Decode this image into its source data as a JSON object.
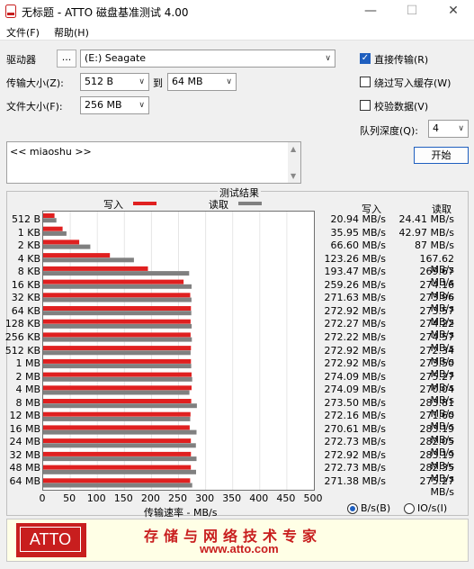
{
  "window": {
    "title": "无标题 - ATTO 磁盘基准测试 4.00",
    "minimize": "—",
    "maximize": "☐",
    "close": "✕"
  },
  "menu": [
    "文件(F)",
    "帮助(H)"
  ],
  "drive": {
    "label": "驱动器",
    "browse": "...",
    "value": "(E:) Seagate"
  },
  "transfer": {
    "label": "传输大小(Z):",
    "from": "512 B",
    "to_label": "到",
    "to": "64 MB"
  },
  "filesize": {
    "label": "文件大小(F):",
    "value": "256 MB"
  },
  "options": {
    "direct_io": {
      "label": "直接传输(R)",
      "checked": true
    },
    "bypass_cache": {
      "label": "绕过写入缓存(W)",
      "checked": false
    },
    "verify": {
      "label": "校验数据(V)",
      "checked": false
    }
  },
  "queue": {
    "label": "队列深度(Q):",
    "value": "4"
  },
  "start_button": "开始",
  "notes_text": "<< miaoshu >>",
  "results": {
    "title": "测试结果",
    "write_label": "写入",
    "read_label": "读取",
    "col_write": "写入",
    "col_read": "读取",
    "rows": [
      {
        "size": "512 B",
        "write": "20.94 MB/s",
        "read": "24.41 MB/s"
      },
      {
        "size": "1 KB",
        "write": "35.95 MB/s",
        "read": "42.97 MB/s"
      },
      {
        "size": "2 KB",
        "write": "66.60 MB/s",
        "read": "87 MB/s"
      },
      {
        "size": "4 KB",
        "write": "123.26 MB/s",
        "read": "167.62 MB/s"
      },
      {
        "size": "8 KB",
        "write": "193.47 MB/s",
        "read": "269.67 MB/s"
      },
      {
        "size": "16 KB",
        "write": "259.26 MB/s",
        "read": "274.16 MB/s"
      },
      {
        "size": "32 KB",
        "write": "271.63 MB/s",
        "read": "273.96 MB/s"
      },
      {
        "size": "64 KB",
        "write": "272.92 MB/s",
        "read": "273.57 MB/s"
      },
      {
        "size": "128 KB",
        "write": "272.27 MB/s",
        "read": "274.22 MB/s"
      },
      {
        "size": "256 KB",
        "write": "272.22 MB/s",
        "read": "274.57 MB/s"
      },
      {
        "size": "512 KB",
        "write": "272.92 MB/s",
        "read": "272.34 MB/s"
      },
      {
        "size": "1 MB",
        "write": "272.92 MB/s",
        "read": "273.50 MB/s"
      },
      {
        "size": "2 MB",
        "write": "274.09 MB/s",
        "read": "275.27 MB/s"
      },
      {
        "size": "4 MB",
        "write": "274.09 MB/s",
        "read": "270.04 MB/s"
      },
      {
        "size": "8 MB",
        "write": "273.50 MB/s",
        "read": "283.81 MB/s"
      },
      {
        "size": "12 MB",
        "write": "272.16 MB/s",
        "read": "271.60 MB/s"
      },
      {
        "size": "16 MB",
        "write": "270.61 MB/s",
        "read": "283.19 MB/s"
      },
      {
        "size": "24 MB",
        "write": "272.73 MB/s",
        "read": "282.05 MB/s"
      },
      {
        "size": "32 MB",
        "write": "272.92 MB/s",
        "read": "283.19 MB/s"
      },
      {
        "size": "48 MB",
        "write": "272.73 MB/s",
        "read": "282.35 MB/s"
      },
      {
        "size": "64 MB",
        "write": "271.38 MB/s",
        "read": "275.27 MB/s"
      }
    ],
    "xlabel": "传输速率 - MB/s",
    "unit_bs": "B/s(B)",
    "unit_ios": "IO/s(I)",
    "unit_selected": "B/s"
  },
  "chart_data": {
    "type": "bar",
    "categories": [
      "512 B",
      "1 KB",
      "2 KB",
      "4 KB",
      "8 KB",
      "16 KB",
      "32 KB",
      "64 KB",
      "128 KB",
      "256 KB",
      "512 KB",
      "1 MB",
      "2 MB",
      "4 MB",
      "8 MB",
      "12 MB",
      "16 MB",
      "24 MB",
      "32 MB",
      "48 MB",
      "64 MB"
    ],
    "series": [
      {
        "name": "写入",
        "color": "#e02020",
        "values": [
          20.94,
          35.95,
          66.6,
          123.26,
          193.47,
          259.26,
          271.63,
          272.92,
          272.27,
          272.22,
          272.92,
          272.92,
          274.09,
          274.09,
          273.5,
          272.16,
          270.61,
          272.73,
          272.92,
          272.73,
          271.38
        ]
      },
      {
        "name": "读取",
        "color": "#808080",
        "values": [
          24.41,
          42.97,
          87,
          167.62,
          269.67,
          274.16,
          273.96,
          273.57,
          274.22,
          274.57,
          272.34,
          273.5,
          275.27,
          270.04,
          283.81,
          271.6,
          283.19,
          282.05,
          283.19,
          282.35,
          275.27
        ]
      }
    ],
    "xlim": [
      0,
      500
    ],
    "xticks": [
      "0",
      "50",
      "100",
      "150",
      "200",
      "250",
      "300",
      "350",
      "400",
      "450",
      "500"
    ],
    "xlabel": "传输速率 - MB/s",
    "orientation": "horizontal",
    "grid": true
  },
  "banner": {
    "logo_text": "ATTO",
    "slogan": "存储与网络技术专家",
    "url": "www.atto.com"
  },
  "colors": {
    "write": "#e02020",
    "read": "#808080",
    "brand": "#c81e1e",
    "accent": "#1f5fbf"
  }
}
